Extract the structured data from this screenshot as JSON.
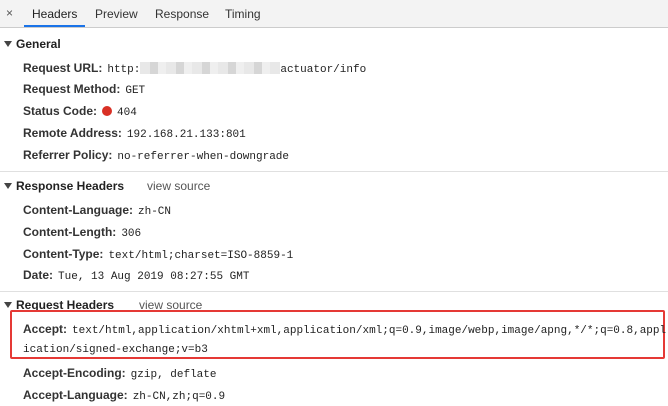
{
  "tabs": {
    "close_symbol": "×",
    "items": [
      "Headers",
      "Preview",
      "Response",
      "Timing"
    ],
    "active": "Headers"
  },
  "general": {
    "title": "General",
    "rows": [
      {
        "key": "Request URL:",
        "value_prefix": "http:",
        "value_suffix": "actuator/info"
      },
      {
        "key": "Request Method:",
        "value": "GET"
      },
      {
        "key": "Status Code:",
        "value": "404",
        "status_color": "#d93025"
      },
      {
        "key": "Remote Address:",
        "value": "192.168.21.133:801"
      },
      {
        "key": "Referrer Policy:",
        "value": "no-referrer-when-downgrade"
      }
    ]
  },
  "response_headers": {
    "title": "Response Headers",
    "view_source": "view source",
    "rows": [
      {
        "key": "Content-Language:",
        "value": "zh-CN"
      },
      {
        "key": "Content-Length:",
        "value": "306"
      },
      {
        "key": "Content-Type:",
        "value": "text/html;charset=ISO-8859-1"
      },
      {
        "key": "Date:",
        "value": "Tue, 13 Aug 2019 08:27:55 GMT"
      }
    ]
  },
  "request_headers": {
    "title": "Request Headers",
    "view_source": "view source",
    "rows": [
      {
        "key": "Accept:",
        "value": "text/html,application/xhtml+xml,application/xml;q=0.9,image/webp,image/apng,*/*;q=0.8,appl",
        "value_cont": "ication/signed-exchange;v=b3"
      },
      {
        "key": "Accept-Encoding:",
        "value": "gzip, deflate"
      },
      {
        "key": "Accept-Language:",
        "value": "zh-CN,zh;q=0.9"
      }
    ]
  },
  "colors": {
    "highlight_border": "#e53935",
    "active_tab_underline": "#1a73e8"
  }
}
